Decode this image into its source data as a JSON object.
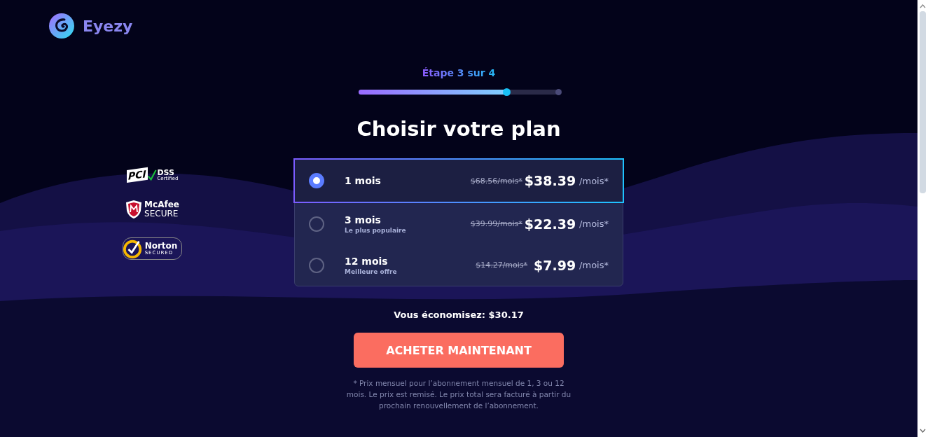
{
  "brand": {
    "name": "Eyezy"
  },
  "progress": {
    "label": "Étape 3 sur 4",
    "level": 0.74
  },
  "title": "Choisir votre plan",
  "badges": [
    {
      "kind": "pci",
      "parts": [
        "PCI",
        "DSS",
        "Certified"
      ]
    },
    {
      "kind": "mcafee",
      "parts": [
        "McAfee",
        "SECURE"
      ]
    },
    {
      "kind": "norton",
      "parts": [
        "Norton",
        "SECURED"
      ]
    }
  ],
  "plans": [
    {
      "name": "1 mois",
      "old_price": "$68.56/mois*",
      "price": "$38.39",
      "unit": "/mois*",
      "selected": true
    },
    {
      "name": "3 mois",
      "note": "Le plus populaire",
      "old_price": "$39.99/mois*",
      "price": "$22.39",
      "unit": "/mois*",
      "selected": false
    },
    {
      "name": "12 mois",
      "note": "Meilleure offre",
      "old_price": "$14.27/mois*",
      "price": "$7.99",
      "unit": "/mois*",
      "selected": false
    }
  ],
  "savings": "Vous économisez: $30.17",
  "buy_button": "ACHETER MAINTENANT",
  "footnote": "* Prix mensuel pour l’abonnement mensuel de 1, 3 ou 12 mois. Le prix est remisé. Le prix total sera facturé à partir du prochain renouvellement de l’abonnement."
}
